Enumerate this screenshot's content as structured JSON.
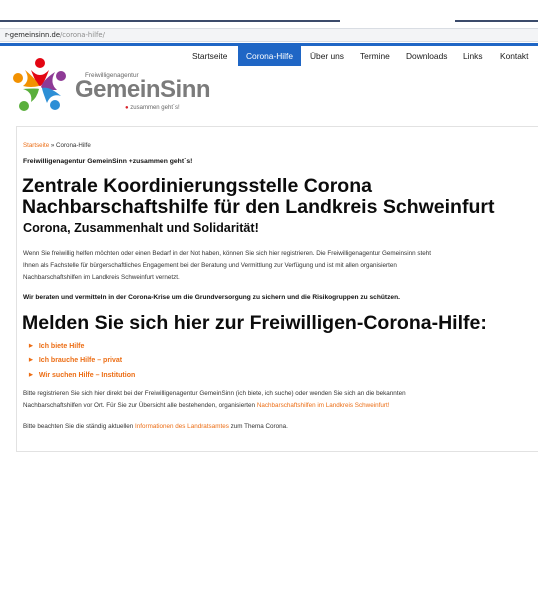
{
  "browser": {
    "url_domain": "r-gemeinsinn.de",
    "url_path": "/corona-hilfe/"
  },
  "nav": {
    "items": [
      "Startseite",
      "Corona-Hilfe",
      "Über uns",
      "Termine",
      "Downloads",
      "Links",
      "Kontakt"
    ],
    "active_index": 1
  },
  "logo": {
    "subtitle": "Freiwilligenagentur",
    "brand": "GemeinSinn",
    "tagline_dot": "●",
    "tagline": "zusammen geht´s!"
  },
  "breadcrumb": {
    "home": "Startseite",
    "separator": " » ",
    "current": "Corona-Hilfe"
  },
  "content": {
    "intro": "Freiwilligenagentur GemeinSinn +zusammen geht´s!",
    "heading_line1": "Zentrale Koordinierungsstelle Corona",
    "heading_line2": "Nachbarschaftshilfe für den Landkreis Schweinfurt",
    "subheading": "Corona, Zusammenhalt und Solidarität!",
    "para1_line1": "Wenn Sie freiwillig helfen möchten oder einen Bedarf in der Not haben, können Sie sich hier registrieren. Die Freiwilligenagentur Gemeinsinn steht",
    "para1_line2": "Ihnen als Fachstelle für bürgerschaftliches Engagement bei der Beratung und Vermittlung zur Verfügung und ist mit allen organisierten",
    "para1_line3": "Nachbarschaftshilfen im Landkreis Schweinfurt vernetzt.",
    "bold_statement": "Wir beraten und vermitteln in der Corona-Krise um die Grundversorgung zu sichern und die Risikogruppen zu schützen.",
    "register_heading": "Melden Sie sich hier zur Freiwilligen-Corona-Hilfe:",
    "options": [
      "Ich biete Hilfe",
      "Ich brauche Hilfe – privat",
      "Wir suchen Hilfe – Institution"
    ],
    "para2_line1": "Bitte registrieren Sie sich hier direkt bei der Freiwilligenagentur GemeinSinn (ich biete, ich suche) oder wenden Sie sich an die bekannten",
    "para2_line2_text": "Nachbarschaftshilfen vor Ort. Für Sie zur Übersicht alle bestehenden, organisierten ",
    "para2_line2_link": "Nachbarschaftshilfen im Landkreis Schweinfurt!",
    "para3_before": "Bitte beachten Sie die ständig aktuellen ",
    "para3_link": "Informationen des Landratsamtes",
    "para3_after": " zum Thema Corona."
  },
  "colors": {
    "nav_active": "#1f66c5",
    "link": "#ec6d14"
  }
}
